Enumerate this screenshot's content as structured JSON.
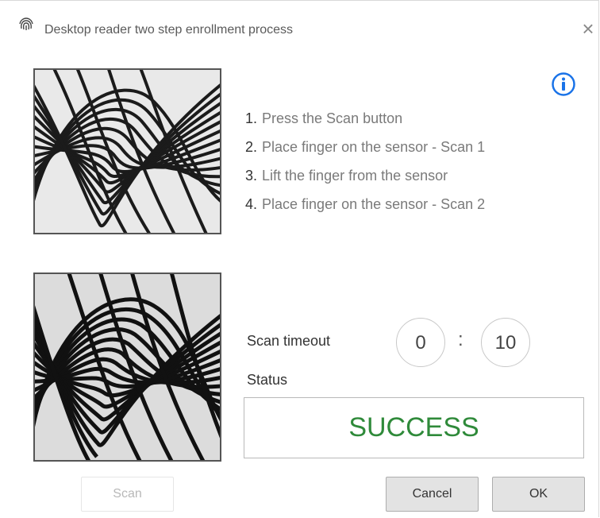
{
  "window": {
    "title": "Desktop reader two step enrollment process",
    "close_glyph": "×"
  },
  "icons": {
    "app": "fingerprint-icon",
    "info": "info-icon",
    "close": "close-icon"
  },
  "steps": [
    {
      "num": "1.",
      "text": "Press the Scan button"
    },
    {
      "num": "2.",
      "text": "Place finger on the sensor - Scan 1"
    },
    {
      "num": "3.",
      "text": "Lift the finger from the sensor"
    },
    {
      "num": "4.",
      "text": "Place finger on the sensor - Scan 2"
    }
  ],
  "timeout": {
    "label": "Scan timeout",
    "minutes": "0",
    "separator": ":",
    "seconds": "10"
  },
  "status": {
    "label": "Status",
    "value": "SUCCESS",
    "color": "#2f8a3a"
  },
  "buttons": {
    "scan": "Scan",
    "cancel": "Cancel",
    "ok": "OK"
  },
  "colors": {
    "info_blue": "#1a73e8",
    "success_green": "#2f8a3a"
  }
}
